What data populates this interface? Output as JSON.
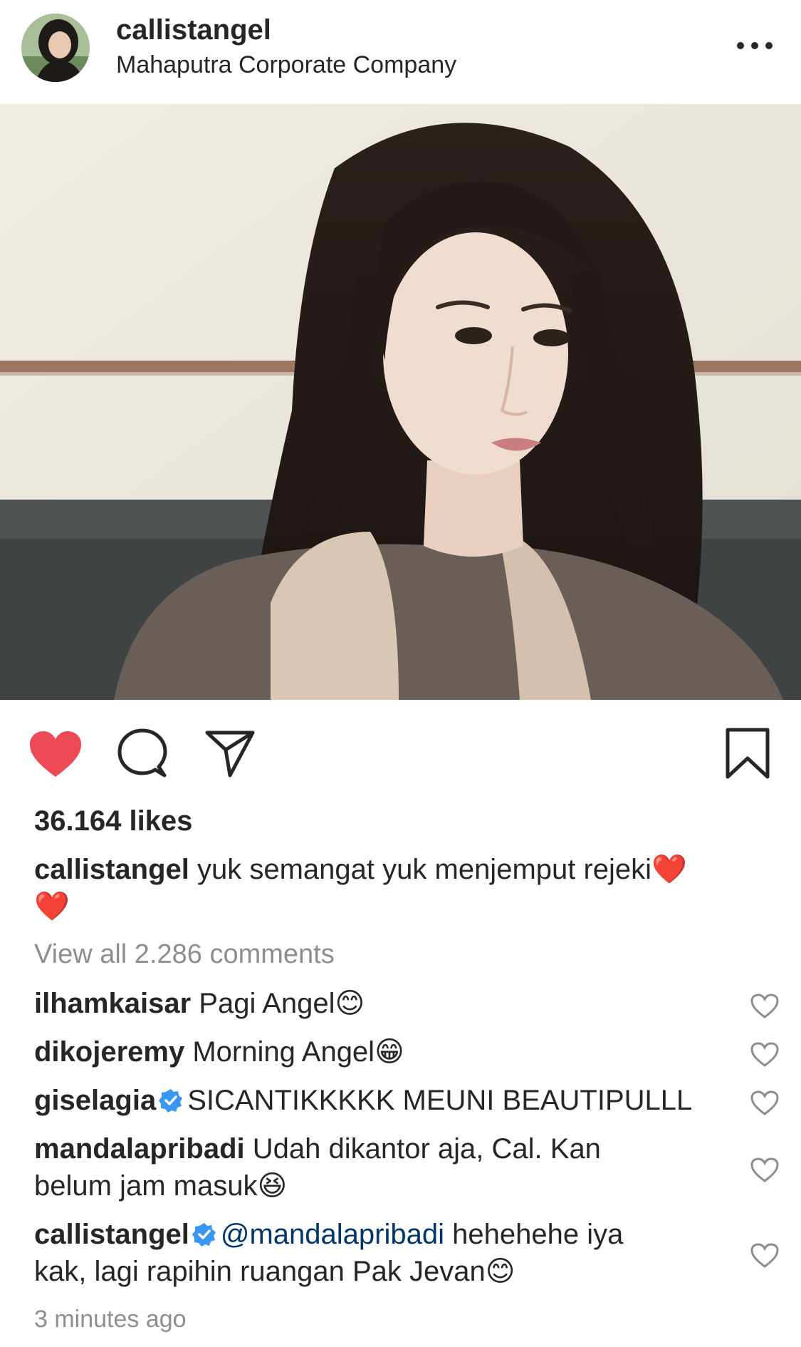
{
  "post": {
    "username": "callistangel",
    "location": "Mahaputra Corporate Company",
    "likes": "36.164 likes",
    "caption_user": "callistangel",
    "caption_text": "yuk semangat yuk menjemput rejeki",
    "caption_emoji_1": "❤️",
    "caption_emoji_2": "❤️",
    "view_all": "View all 2.286 comments",
    "time": "3 minutes ago"
  },
  "comments": [
    {
      "user": "ilhamkaisar",
      "text": "Pagi Angel",
      "emoji": "😊"
    },
    {
      "user": "dikojeremy",
      "text": "Morning Angel",
      "emoji": "😁"
    },
    {
      "user": "giselagia",
      "text": "SICANTIKKKKK MEUNI BEAUTIPULLL",
      "verified": true
    },
    {
      "user": "mandalapribadi",
      "text": "Udah dikantor aja, Cal. Kan",
      "text2": "belum jam masuk",
      "emoji": "😆"
    },
    {
      "user": "callistangel",
      "verified": true,
      "mention": "@mandalapribadi",
      "text": "hehehehe iya",
      "text2": "kak, lagi rapihin ruangan Pak Jevan",
      "emoji": "😊"
    }
  ],
  "colors": {
    "like_red": "#ed4956",
    "verified_blue": "#3897f0",
    "muted": "#8e8e8e"
  },
  "icons": [
    "more-icon",
    "heart-filled-icon",
    "comment-icon",
    "share-icon",
    "bookmark-icon",
    "heart-outline-icon",
    "verified-icon"
  ]
}
